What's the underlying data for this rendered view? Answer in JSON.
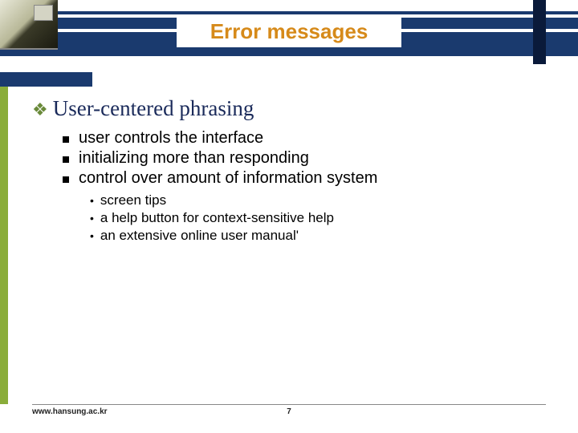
{
  "title": "Error messages",
  "heading": "User-centered phrasing",
  "level2": [
    "user controls the interface",
    "initializing more than responding",
    "control over amount of information system"
  ],
  "level3": [
    "screen tips",
    "a help button for context-sensitive help",
    "an extensive online user manual'"
  ],
  "footer": {
    "url": "www.hansung.ac.kr",
    "page": "7"
  }
}
